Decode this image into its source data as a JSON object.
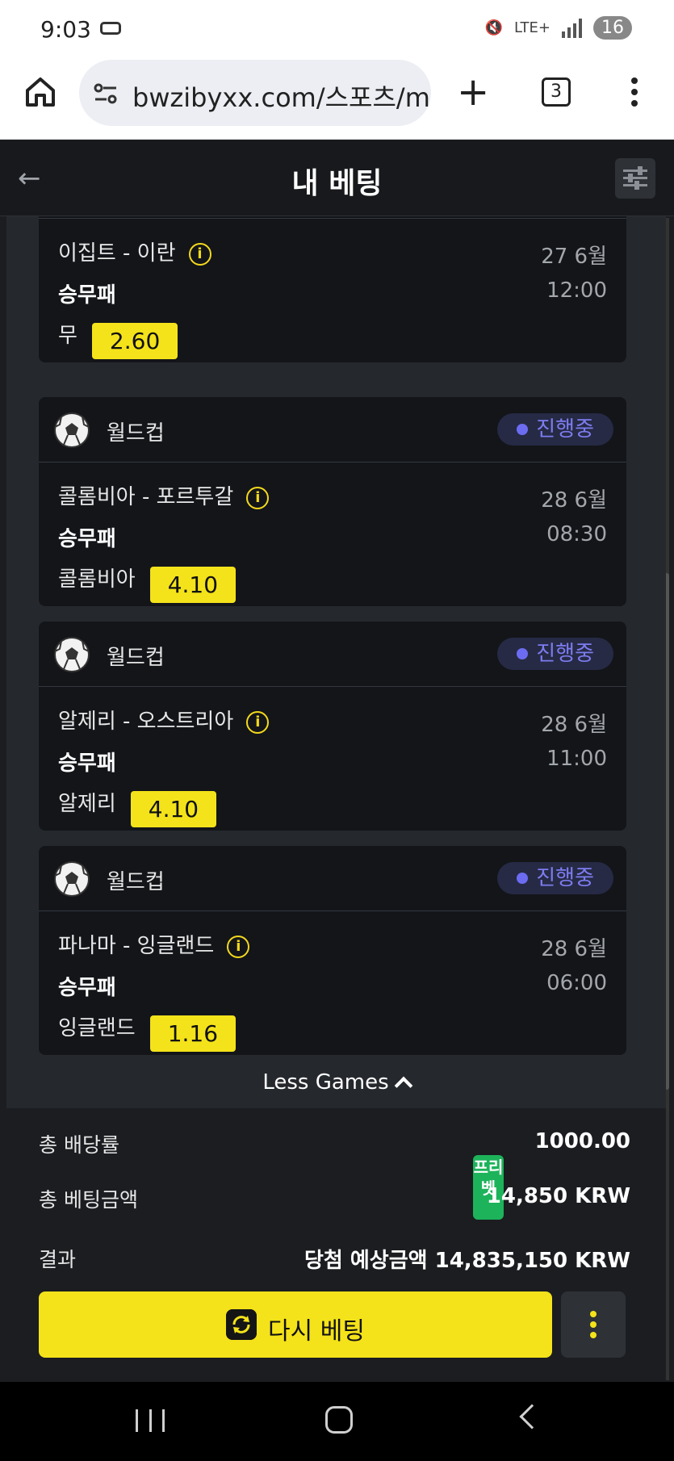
{
  "status_bar": {
    "time": "9:03",
    "network": "LTE+",
    "battery": "16"
  },
  "browser": {
    "url": "bwzibyxx.com/스포츠/ma",
    "tab_count": "3"
  },
  "header": {
    "title": "내 베팅"
  },
  "bets": [
    {
      "league": "",
      "status": "",
      "match": "이집트 - 이란",
      "date": "27 6월",
      "market": "승무패",
      "time": "12:00",
      "pick": "무",
      "odds": "2.60"
    },
    {
      "league": "월드컵",
      "status": "진행중",
      "match": "콜롬비아 - 포르투갈",
      "date": "28 6월",
      "market": "승무패",
      "time": "08:30",
      "pick": "콜롬비아",
      "odds": "4.10"
    },
    {
      "league": "월드컵",
      "status": "진행중",
      "match": "알제리 - 오스트리아",
      "date": "28 6월",
      "market": "승무패",
      "time": "11:00",
      "pick": "알제리",
      "odds": "4.10"
    },
    {
      "league": "월드컵",
      "status": "진행중",
      "match": "파나마 - 잉글랜드",
      "date": "28 6월",
      "market": "승무패",
      "time": "06:00",
      "pick": "잉글랜드",
      "odds": "1.16"
    }
  ],
  "less_games_label": "Less Games",
  "summary": {
    "total_odds_label": "총 배당률",
    "total_odds_value": "1000.00",
    "total_stake_label": "총 베팅금액",
    "freebet_badge": "프리벳",
    "total_stake_value": "14,850 KRW",
    "result_label": "결과",
    "result_value": "당첨 예상금액 14,835,150 KRW"
  },
  "actions": {
    "rebet_label": "다시 베팅"
  },
  "colors": {
    "accent": "#f4e31a",
    "status": "#7d7cf0",
    "freebet": "#1db35a",
    "card_bg": "#131519"
  }
}
